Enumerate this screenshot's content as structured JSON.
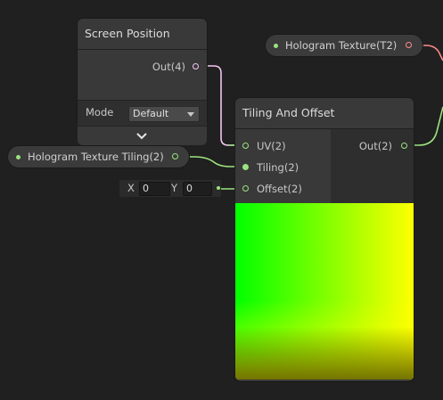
{
  "screen_position_node": {
    "title": "Screen Position",
    "output_label": "Out(4)",
    "mode_label": "Mode",
    "mode_value": "Default",
    "expand_icon": "chevron-down-icon"
  },
  "tiling_offset_node": {
    "title": "Tiling And Offset",
    "inputs": [
      "UV(2)",
      "Tiling(2)",
      "Offset(2)"
    ],
    "output_label": "Out(2)"
  },
  "offset_inline": {
    "x_label": "X",
    "x_value": "0",
    "y_label": "Y",
    "y_value": "0"
  },
  "property_tiling": {
    "label": "Hologram Texture Tiling(2)"
  },
  "property_texture": {
    "label": "Hologram Texture(T2)"
  },
  "colors": {
    "background": "#202020",
    "node": "#393939",
    "vector2_port": "#9be37f",
    "vector4_port": "#f3c5f1",
    "texture_port": "#ff8b8b"
  }
}
